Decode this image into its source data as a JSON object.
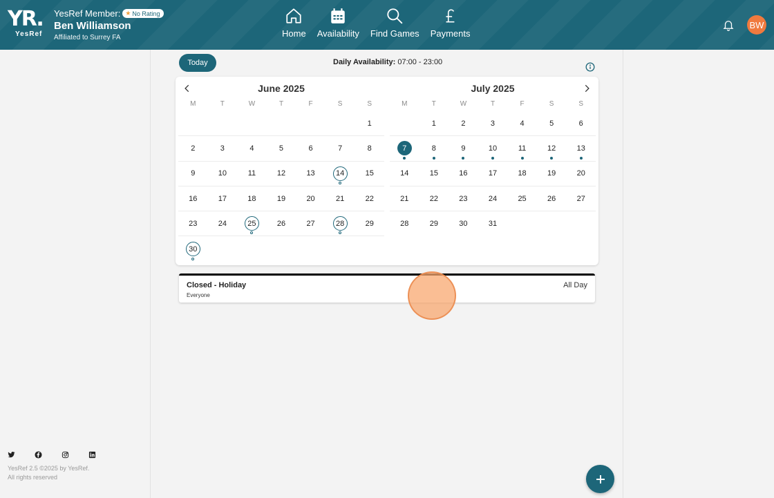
{
  "header": {
    "logo_mark": "YR.",
    "logo_sub": "YesRef",
    "member_label": "YesRef Member:",
    "rating": "No Rating",
    "name": "Ben Williamson",
    "affiliation": "Affiliated to Surrey FA",
    "avatar_initials": "BW",
    "nav": [
      {
        "label": "Home",
        "icon": "home-icon"
      },
      {
        "label": "Availability",
        "icon": "calendar-icon"
      },
      {
        "label": "Find Games",
        "icon": "search-icon"
      },
      {
        "label": "Payments",
        "icon": "pound-icon"
      }
    ]
  },
  "toolbar": {
    "today_label": "Today",
    "daily_label": "Daily Availability:",
    "daily_value": "07:00 - 23:00"
  },
  "calendar": {
    "weekday_initials": [
      "M",
      "T",
      "W",
      "T",
      "F",
      "S",
      "S"
    ],
    "months": [
      {
        "title": "June 2025",
        "weeks": [
          [
            "",
            "",
            "",
            "",
            "",
            "",
            "1"
          ],
          [
            "2",
            "3",
            "4",
            "5",
            "6",
            "7",
            "8"
          ],
          [
            "9",
            "10",
            "11",
            "12",
            "13",
            "14",
            "15"
          ],
          [
            "16",
            "17",
            "18",
            "19",
            "20",
            "21",
            "22"
          ],
          [
            "23",
            "24",
            "25",
            "26",
            "27",
            "28",
            "29"
          ],
          [
            "30",
            "",
            "",
            "",
            "",
            "",
            ""
          ]
        ],
        "ringed_days": [
          "14",
          "25",
          "28",
          "30"
        ],
        "hollow_dot_days": [
          "14",
          "25",
          "28",
          "30"
        ],
        "filled_dot_days": [],
        "today": ""
      },
      {
        "title": "July 2025",
        "weeks": [
          [
            "",
            "1",
            "2",
            "3",
            "4",
            "5",
            "6"
          ],
          [
            "7",
            "8",
            "9",
            "10",
            "11",
            "12",
            "13"
          ],
          [
            "14",
            "15",
            "16",
            "17",
            "18",
            "19",
            "20"
          ],
          [
            "21",
            "22",
            "23",
            "24",
            "25",
            "26",
            "27"
          ],
          [
            "28",
            "29",
            "30",
            "31",
            "",
            "",
            ""
          ]
        ],
        "ringed_days": [],
        "hollow_dot_days": [],
        "filled_dot_days": [
          "7",
          "8",
          "9",
          "10",
          "11",
          "12",
          "13"
        ],
        "today": "7"
      }
    ]
  },
  "event": {
    "title": "Closed - Holiday",
    "subtitle": "Everyone",
    "time": "All Day"
  },
  "footer": {
    "version_line": "YesRef 2.5 ©2025 by YesRef.",
    "rights_line": "All rights reserved",
    "socials": [
      "twitter-icon",
      "facebook-icon",
      "instagram-icon",
      "linkedin-icon"
    ]
  },
  "colors": {
    "brand": "#1d6679",
    "avatar": "#f07a3e",
    "rating_star": "#f2a03d"
  }
}
